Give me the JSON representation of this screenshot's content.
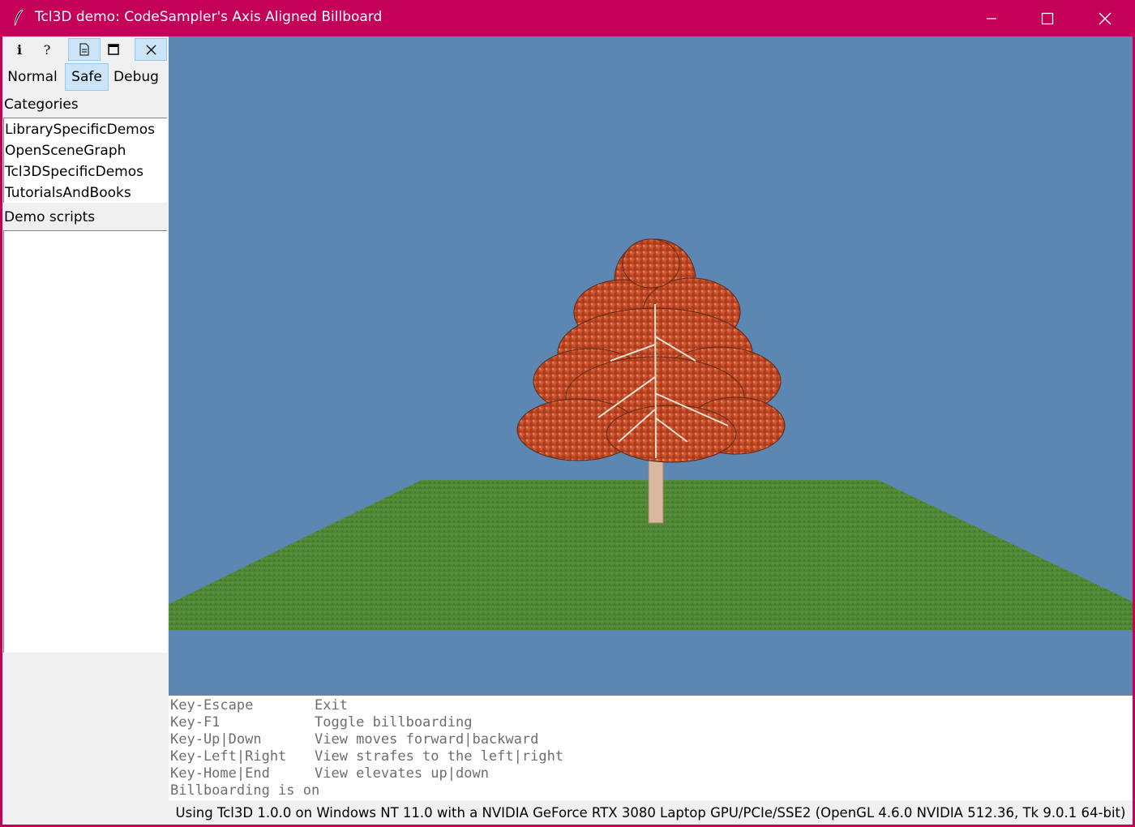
{
  "window": {
    "title": "Tcl3D demo: CodeSampler's Axis Aligned Billboard",
    "controls": [
      "minimize",
      "maximize",
      "close"
    ]
  },
  "toolbar": {
    "buttons": [
      {
        "icon": "info-icon",
        "glyph": "i"
      },
      {
        "icon": "help-icon",
        "glyph": "?"
      },
      {
        "icon": "document-icon"
      },
      {
        "icon": "window-icon"
      },
      {
        "icon": "close-icon"
      }
    ]
  },
  "modes": [
    {
      "label": "Normal",
      "selected": false
    },
    {
      "label": "Safe",
      "selected": true
    },
    {
      "label": "Debug",
      "selected": false
    }
  ],
  "categories": {
    "label": "Categories",
    "items": [
      "LibrarySpecificDemos",
      "OpenSceneGraph",
      "Tcl3DSpecificDemos",
      "TutorialsAndBooks"
    ]
  },
  "demo_scripts": {
    "label": "Demo scripts",
    "items": []
  },
  "console": {
    "lines": [
      {
        "key": "Key-Escape",
        "desc": "Exit"
      },
      {
        "key": "Key-F1",
        "desc": "Toggle billboarding"
      },
      {
        "key": "Key-Up|Down",
        "desc": "View moves forward|backward"
      },
      {
        "key": "Key-Left|Right",
        "desc": "View strafes to the left|right"
      },
      {
        "key": "Key-Home|End",
        "desc": "View elevates up|down"
      },
      {
        "key": "Billboarding is on",
        "desc": ""
      }
    ]
  },
  "status": {
    "text": "Using Tcl3D 1.0.0 on Windows NT 11.0 with a NVIDIA GeForce RTX 3080 Laptop GPU/PCIe/SSE2 (OpenGL 4.6.0 NVIDIA 512.36, Tk 9.0.1 64-bit)"
  },
  "colors": {
    "titlebar": "#c50058",
    "sky": "#5b87b2",
    "grass": "#4f8a35",
    "foliage": "#c9502a",
    "selected": "#cce4f7"
  }
}
